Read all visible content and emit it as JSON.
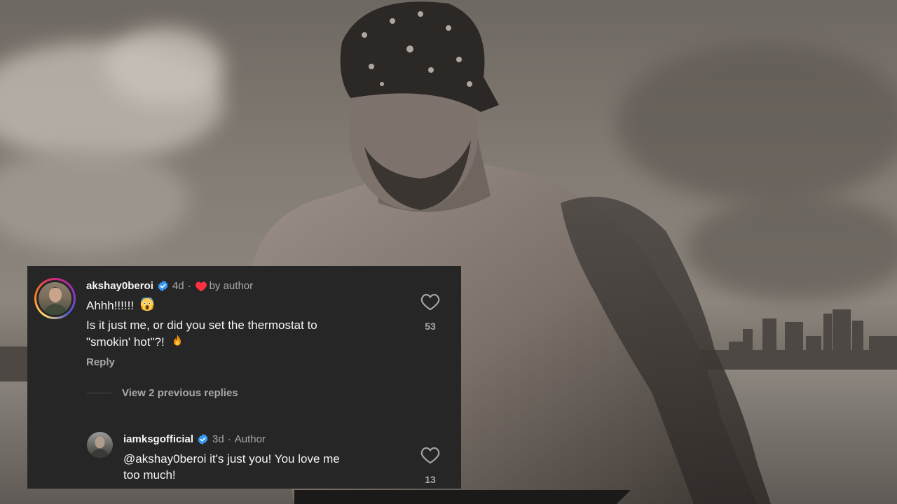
{
  "colors": {
    "card_bg": "#262626",
    "text_primary": "#f5f5f5",
    "text_secondary": "#a8a8a8",
    "verified_blue": "#3797f0",
    "heart_red": "#ff3040"
  },
  "background": {
    "icon": "shirtless-man-with-bandana-photo"
  },
  "comment": {
    "username": "akshay0beroi",
    "verified_icon": "verified-badge-icon",
    "time": "4d",
    "separator": "·",
    "liked_by_author_icon": "heart-icon",
    "liked_by_author_text": "by author",
    "line1": "Ahhh!!!!!!",
    "line1_emoji": "screaming-face-emoji",
    "line2": "Is it just me, or did you set the thermostat to",
    "line3": "\"smokin' hot\"?!",
    "line3_emoji": "fire-emoji",
    "like_icon": "heart-outline-icon",
    "like_count": "53",
    "reply_label": "Reply"
  },
  "view_replies": {
    "label": "View 2 previous replies"
  },
  "reply": {
    "username": "iamksgofficial",
    "verified_icon": "verified-badge-icon",
    "time": "3d",
    "separator": "·",
    "author_label": "Author",
    "line1": "@akshay0beroi it's just you! You love me",
    "line2": "too much!",
    "like_icon": "heart-outline-icon",
    "like_count": "13"
  }
}
